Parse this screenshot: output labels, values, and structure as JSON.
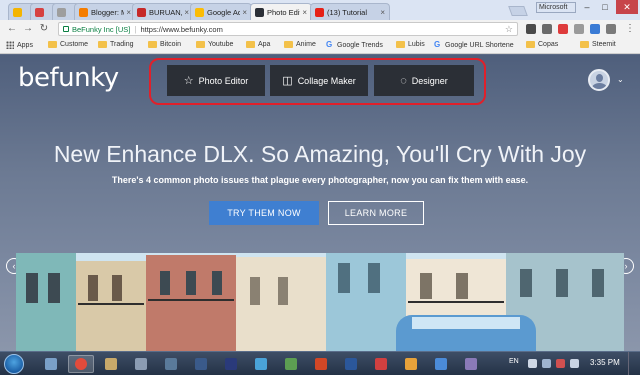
{
  "browser": {
    "tabs": [
      {
        "title": "",
        "favicon_color": "#f4b400",
        "active": false
      },
      {
        "title": "",
        "favicon_color": "#d64141",
        "active": false
      },
      {
        "title": "",
        "favicon_color": "#9e9e9e",
        "active": false
      },
      {
        "title": "Blogger: Mic",
        "favicon_color": "#f57d00",
        "active": false
      },
      {
        "title": "BURUAN, DA",
        "favicon_color": "#c62828",
        "active": false
      },
      {
        "title": "Google AdSe",
        "favicon_color": "#fbbc05",
        "active": false
      },
      {
        "title": "Photo Editor",
        "favicon_color": "#2b2f36",
        "active": true
      },
      {
        "title": "(13) Tutorial",
        "favicon_color": "#e62117",
        "active": false
      }
    ],
    "profile_label": "Microsoft",
    "address": {
      "secure_label": "BeFunky Inc [US]",
      "url": "https://www.befunky.com"
    },
    "bookmarks": [
      {
        "label": "Apps",
        "icon": "apps-grid-icon"
      },
      {
        "label": "Custome",
        "icon": "folder-icon"
      },
      {
        "label": "Trading",
        "icon": "folder-icon"
      },
      {
        "label": "Bitcoin",
        "icon": "folder-icon"
      },
      {
        "label": "Youtube",
        "icon": "folder-icon"
      },
      {
        "label": "Apa",
        "icon": "folder-icon"
      },
      {
        "label": "Anime",
        "icon": "folder-icon"
      },
      {
        "label": "Google Trends",
        "icon": "google-icon"
      },
      {
        "label": "Lubis",
        "icon": "folder-icon"
      },
      {
        "label": "Google URL Shortene",
        "icon": "google-icon"
      },
      {
        "label": "Copas",
        "icon": "folder-icon"
      },
      {
        "label": "Steemit",
        "icon": "folder-icon"
      }
    ]
  },
  "site": {
    "logo": "befunky",
    "nav": [
      {
        "label": "Photo Editor",
        "icon": "wand-icon"
      },
      {
        "label": "Collage Maker",
        "icon": "collage-icon"
      },
      {
        "label": "Designer",
        "icon": "designer-icon"
      }
    ],
    "headline": "New Enhance DLX. So Amazing, You'll Cry With Joy",
    "subline": "There's 4 common photo issues that plague every photographer, now you can fix them with ease.",
    "primary_button": "TRY THEM NOW",
    "secondary_button": "LEARN MORE",
    "colors": {
      "primary": "#3f7fd1",
      "nav_bg": "#2b2f36",
      "highlight": "#e0202a"
    }
  },
  "taskbar": {
    "language": "EN",
    "clock": "3:35 PM"
  }
}
